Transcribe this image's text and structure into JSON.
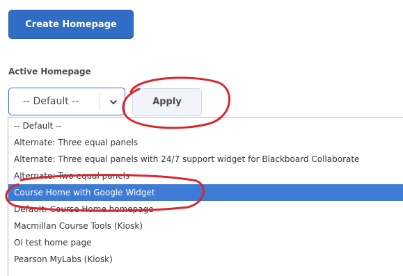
{
  "create_button": {
    "label": "Create Homepage"
  },
  "active_homepage": {
    "label": "Active Homepage",
    "select_value": "-- Default --",
    "apply_label": "Apply"
  },
  "dropdown": {
    "items": [
      "-- Default --",
      "Alternate: Three equal panels",
      "Alternate: Three equal panels with 24/7 support widget for Blackboard Collaborate",
      "Alternate: Two equal panels",
      "Course Home with Google Widget",
      "Default: Course Home homepage",
      "Macmillan Course Tools (Kiosk)",
      "OI test home page",
      "Pearson MyLabs (Kiosk)"
    ],
    "selected_item": "Course Home with Google Widget"
  },
  "colors": {
    "primary_button": "#2f6ec4",
    "selected_row": "#3d7bd5",
    "annotation": "#d9262c"
  }
}
